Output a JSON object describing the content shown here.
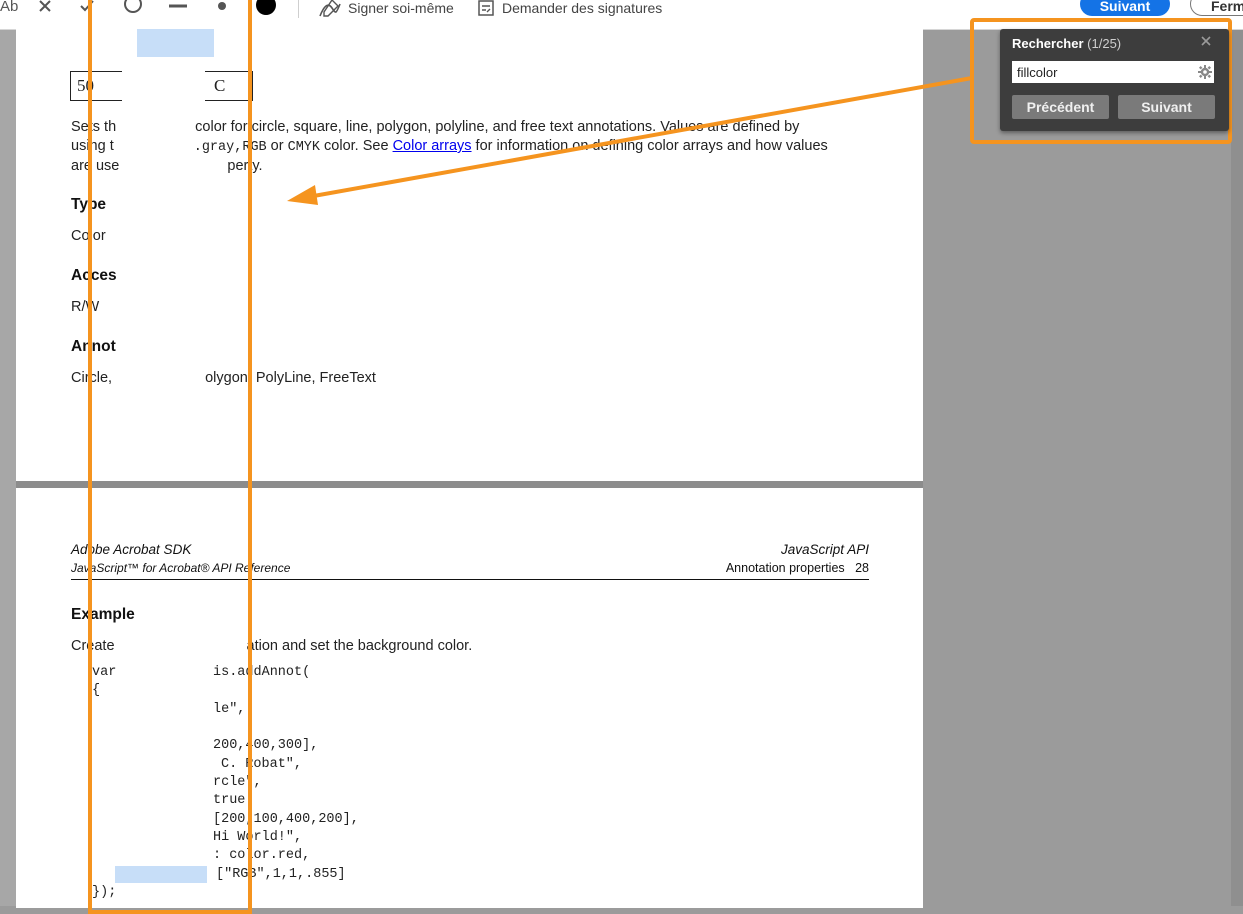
{
  "toolbar": {
    "text_tool_label": "Ab",
    "signer_label": "Signer soi-même",
    "request_label": "Demander des signatures",
    "next_label": "Suivant",
    "close_label": "Ferm"
  },
  "page1": {
    "boxed_left": "50",
    "boxed_right": "C",
    "para_seg1": "Sets th",
    "para_seg2": " color for circle, square, line, polygon, polyline, and free text annotations. Values are defined by",
    "para_line2_a": "using t",
    "para_line2_mono": ".gray,",
    "para_line2_mono2": "RGB",
    "para_line2_b": " or ",
    "para_line2_mono3": "CMYK",
    "para_line2_c": " color. See ",
    "para_line2_link": "Color arrays",
    "para_line2_d": " for information on defining color arrays and how values",
    "para_line3_a": "are use",
    "para_line3_b": "perty.",
    "type_heading": "Type",
    "type_value": "Color",
    "access_heading": "Acces",
    "access_value": "R/W",
    "annot_heading": "Annot",
    "annot_value_a": "Circle,",
    "annot_value_b": "olygon, PolyLine, FreeText"
  },
  "page2": {
    "header_left_1": "Adobe Acrobat SDK",
    "header_left_2": "JavaScript™ for Acrobat® API Reference",
    "header_right_1": "JavaScript API",
    "header_right_2": "Annotation properties",
    "page_number": "28",
    "example_heading": "Example",
    "example_text_a": "Create",
    "example_text_b": "ation and set the background color.",
    "code": {
      "l1a": "var",
      "l1b": "is.addAnnot(",
      "l2": "{",
      "l3": "le\",",
      "l4": "200,400,300],",
      "l5": "C. Robat\",",
      "l6": "rcle\",",
      "l7": "true",
      "l8": "[200,100,400,200],",
      "l9": "Hi World!\",",
      "l10": ": color.red,",
      "l11": "[\"RGB\",1,1,.855]",
      "l12": "});"
    }
  },
  "find": {
    "title": "Rechercher",
    "count": "(1/25)",
    "query": "fillcolor",
    "prev_label": "Précédent",
    "next_label": "Suivant"
  },
  "colors": {
    "annotation_orange": "#f5941f",
    "accent_blue": "#1473e6",
    "selection_blue": "#c7def8"
  }
}
